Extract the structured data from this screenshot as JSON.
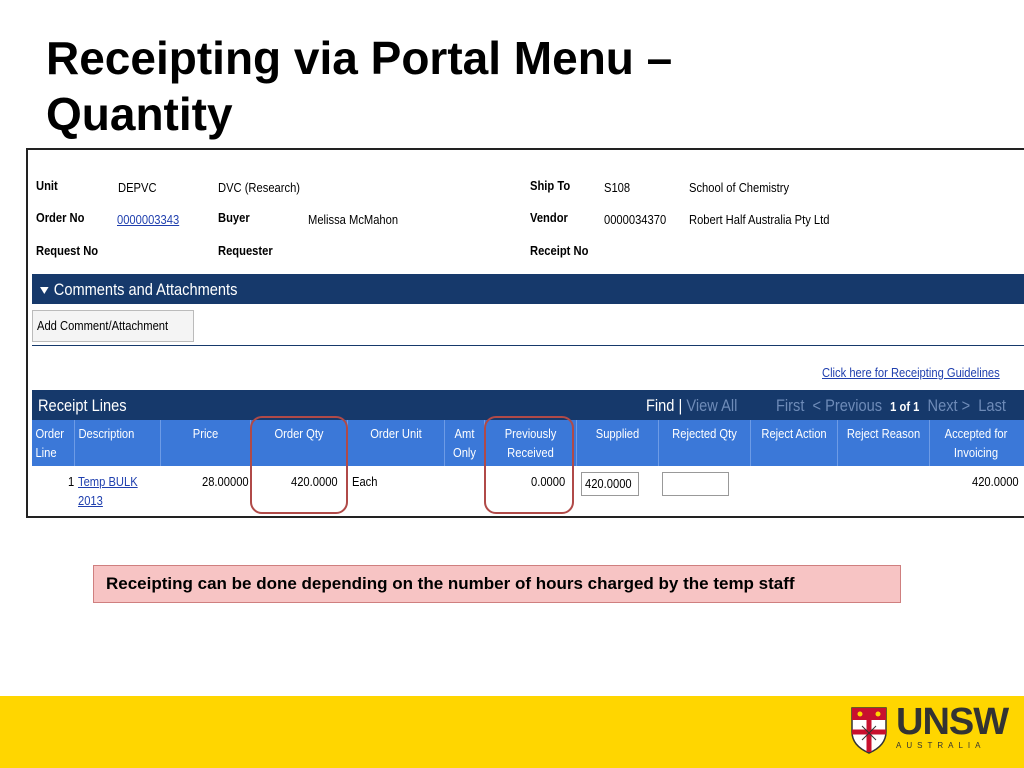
{
  "slide": {
    "title_line1": "Receipting via Portal Menu –",
    "title_line2": "Quantity"
  },
  "header": {
    "unit_label": "Unit",
    "unit_value": "DEPVC",
    "unit_desc": "DVC (Research)",
    "order_label": "Order No",
    "order_value": "0000003343",
    "buyer_label": "Buyer",
    "buyer_value": "Melissa McMahon",
    "request_label": "Request No",
    "requester_label": "Requester",
    "shipto_label": "Ship To",
    "shipto_code": "S108",
    "shipto_name": "School of Chemistry",
    "vendor_label": "Vendor",
    "vendor_code": "0000034370",
    "vendor_name": "Robert Half Australia Pty Ltd",
    "receipt_label": "Receipt No"
  },
  "comments": {
    "title": "Comments and Attachments",
    "add_button": "Add Comment/Attachment"
  },
  "guidelines_link": "Click here for Receipting Guidelines",
  "receipt_lines": {
    "title": "Receipt Lines",
    "nav": {
      "find": "Find",
      "sep": "|",
      "view_all": "View All",
      "first": "First",
      "previous": "< Previous",
      "page": "1 of 1",
      "next": "Next >",
      "last": "Last"
    },
    "columns": [
      {
        "line1": "Order",
        "line2": "Line"
      },
      {
        "line1": "Description",
        "line2": ""
      },
      {
        "line1": "Price",
        "line2": ""
      },
      {
        "line1": "Order Qty",
        "line2": ""
      },
      {
        "line1": "Order Unit",
        "line2": ""
      },
      {
        "line1": "Amt",
        "line2": "Only"
      },
      {
        "line1": "Previously",
        "line2": "Received"
      },
      {
        "line1": "Supplied",
        "line2": ""
      },
      {
        "line1": "Rejected Qty",
        "line2": ""
      },
      {
        "line1": "Reject Action",
        "line2": ""
      },
      {
        "line1": "Reject Reason",
        "line2": ""
      },
      {
        "line1": "Accepted for",
        "line2": "Invoicing"
      }
    ],
    "rows": [
      {
        "line": "1",
        "desc_line1": "Temp BULK",
        "desc_line2": "2013",
        "price": "28.00000",
        "order_qty": "420.0000",
        "order_unit": "Each",
        "prev_received": "0.0000",
        "supplied": "420.0000",
        "rejected_qty": "",
        "accepted": "420.0000"
      }
    ]
  },
  "note": "Receipting can be done depending on the number of hours charged by the temp staff",
  "footer": {
    "logo_text": "UNSW",
    "logo_sub": "AUSTRALIA"
  },
  "colors": {
    "nav_bar": "#16396b",
    "column_header": "#3b78d8",
    "footer": "#ffd600",
    "highlight": "#b04a48",
    "note_bg": "#f7c4c4"
  }
}
